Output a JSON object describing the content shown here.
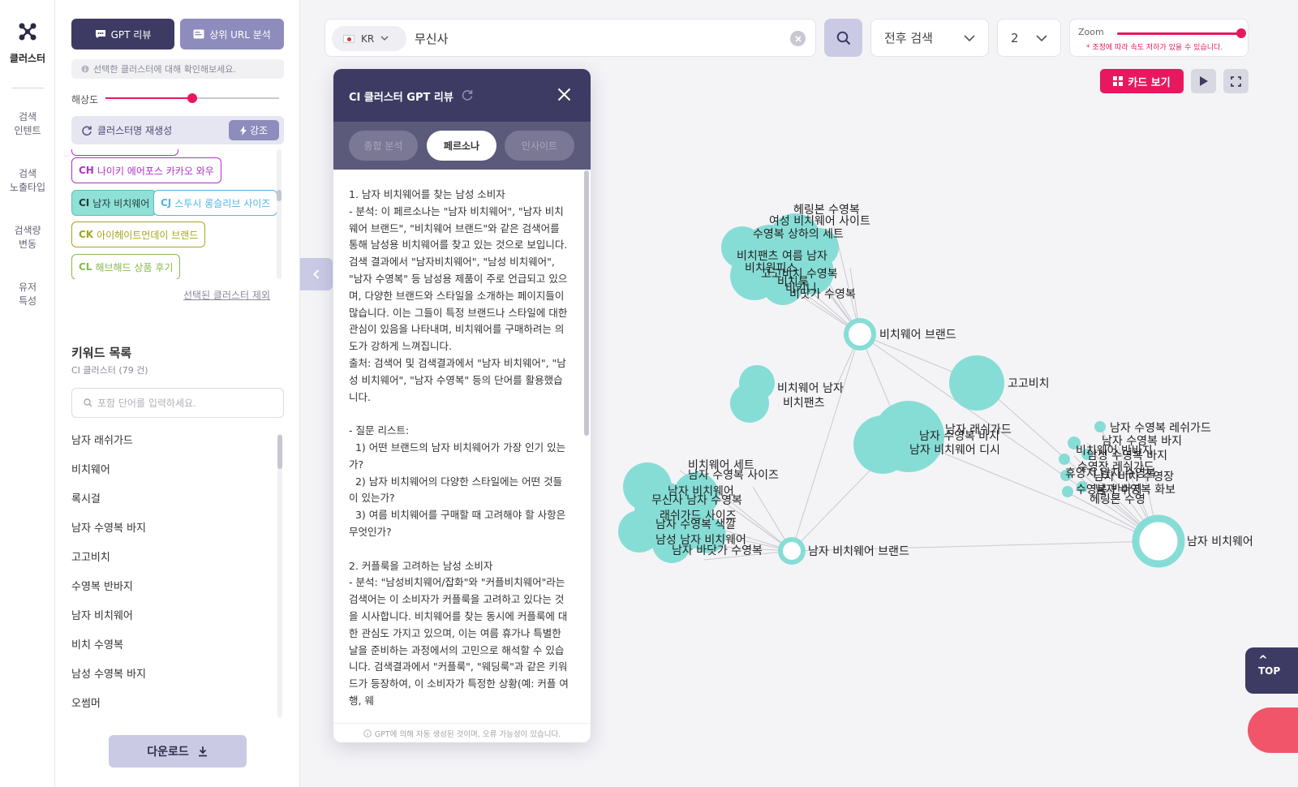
{
  "rail": {
    "logo_label": "클러스터",
    "nav": [
      "검색\n인텐트",
      "검색\n노출타입",
      "검색량\n변동",
      "유저\n특성"
    ]
  },
  "panel": {
    "gpt_review_label": "GPT 리뷰",
    "top_url_label": "상위 URL 분석",
    "hint": "선택한 클러스터에 대해 확인해보세요.",
    "resolution_label": "해상도",
    "resolution_value": 0.5,
    "regen_label": "클러스터명 재생성",
    "emphasis_label": "강조",
    "chips": [
      {
        "code": "CH",
        "label": "나이키 에어포스 카카오 와우",
        "color": "#b032c9",
        "selected": false
      },
      {
        "code": "CI",
        "label": "남자 비치웨어",
        "color": "#2f8c86",
        "selected": true
      },
      {
        "code": "CJ",
        "label": "스투시 롱슬리브 사이즈",
        "color": "#55b6e3",
        "selected": false
      },
      {
        "code": "CK",
        "label": "아이헤이트먼데이 브랜드",
        "color": "#a7a51b",
        "selected": false
      },
      {
        "code": "CL",
        "label": "해브해드 상품 후기",
        "color": "#8ab84e",
        "selected": false
      }
    ],
    "exclude_label": "선택된 클러스터 제외",
    "keywords_title": "키워드 목록",
    "keywords_count": "CI 클러스터 (79 건)",
    "keyword_search_placeholder": "포함 단어를 입력하세요.",
    "keywords": [
      "남자 래쉬가드",
      "비치웨어",
      "록시걸",
      "남자 수영복 바지",
      "고고비치",
      "수영복 반바지",
      "남자 비치웨어",
      "비치 수영복",
      "남성 수영복 바지",
      "오썸머"
    ],
    "download_label": "다운로드"
  },
  "topbar": {
    "country": "KR",
    "query": "무신사",
    "mode": "전후 검색",
    "depth": "2",
    "zoom_label": "Zoom",
    "zoom_note": "* 조정에 따라 속도 저하가 있을 수 있습니다.",
    "zoom_value": 1.0,
    "card_view_label": "카드 보기"
  },
  "gpt_panel": {
    "title": "CI 클러스터 GPT 리뷰",
    "tabs": [
      {
        "label": "종합 분석",
        "active": false
      },
      {
        "label": "페르소나",
        "active": true
      },
      {
        "label": "인사이트",
        "active": false
      }
    ],
    "body": "1. 남자 비치웨어를 찾는 남성 소비자\n- 분석: 이 페르소나는 \"남자 비치웨어\", \"남자 비치웨어 브랜드\", \"비치웨어 브랜드\"와 같은 검색어를 통해 남성용 비치웨어를 찾고 있는 것으로 보입니다. 검색 결과에서 \"남자비치웨어\", \"남성 비치웨어\", \"남자 수영복\" 등 남성용 제품이 주로 언급되고 있으며, 다양한 브랜드와 스타일을 소개하는 페이지들이 많습니다. 이는 그들이 특정 브랜드나 스타일에 대한 관심이 있음을 나타내며, 비치웨어를 구매하려는 의도가 강하게 느껴집니다.\n출처: 검색어 및 검색결과에서 \"남자 비치웨어\", \"남성 비치웨어\", \"남자 수영복\" 등의 단어를 활용했습니다.\n\n- 질문 리스트:\n  1) 어떤 브랜드의 남자 비치웨어가 가장 인기 있는가?\n  2) 남자 비치웨어의 다양한 스타일에는 어떤 것들이 있는가?\n  3) 여름 비치웨어를 구매할 때 고려해야 할 사항은 무엇인가?\n\n2. 커플룩을 고려하는 남성 소비자\n- 분석: \"남성비치웨어/잡화\"와 \"커플비치웨어\"라는 검색어는 이 소비자가 커플룩을 고려하고 있다는 것을 시사합니다. 비치웨어를 찾는 동시에 커플룩에 대한 관심도 가지고 있으며, 이는 여름 휴가나 특별한 날을 준비하는 과정에서의 고민으로 해석할 수 있습니다. 검색결과에서 \"커플룩\", \"웨딩룩\"과 같은 키워드가 등장하여, 이 소비자가 특정한 상황(예: 커플 여행, 웨",
    "footer": "GPT에 의해 자동 생성된 것이며, 오류 가능성이 있습니다."
  },
  "graph": {
    "node_color": "#86ddd6",
    "hubs": [
      {
        "label": "비치웨어 브랜드"
      },
      {
        "label": "남자 비치웨어 브랜드"
      },
      {
        "label": "남자 비치웨어"
      }
    ],
    "nodes": [
      {
        "label": "고고비치"
      },
      {
        "label": "비치웨어 남자"
      },
      {
        "label": "비치팬츠"
      },
      {
        "label": "남자 래쉬가드"
      },
      {
        "label": "남자 수영복 바지"
      },
      {
        "label": "남자 비치웨어 디시"
      }
    ],
    "clusters": {
      "top": [
        "헤링본 수영복",
        "여성 비치웨어 사이트",
        "수영복 상하의 세트",
        "비치팬츠 여름 남자",
        "고고비치 수영복",
        "비치원피스",
        "비치룩",
        "비키니",
        "비닷가 수영복"
      ],
      "bottom": [
        "비치웨어 세트",
        "남자 수영복 사이즈",
        "무신사 남자 수영복",
        "남자 비치웨어",
        "래쉬가드 사이즈",
        "남자 수영복 색깔",
        "남성 남자 비치웨어",
        "남자 바닷가 수영복"
      ],
      "right": [
        "남자 수영복 레쉬가드",
        "남자 수영복 바지",
        "비치웨어 반바지",
        "남성 수영복 바지",
        "수영장 레쉬가드",
        "휴양지 남자 수영복",
        "남자 비치 수영장",
        "수영복 반바지",
        "남자 수영복 화보",
        "헤링본 수영"
      ]
    }
  },
  "float": {
    "top_label": "TOP"
  }
}
